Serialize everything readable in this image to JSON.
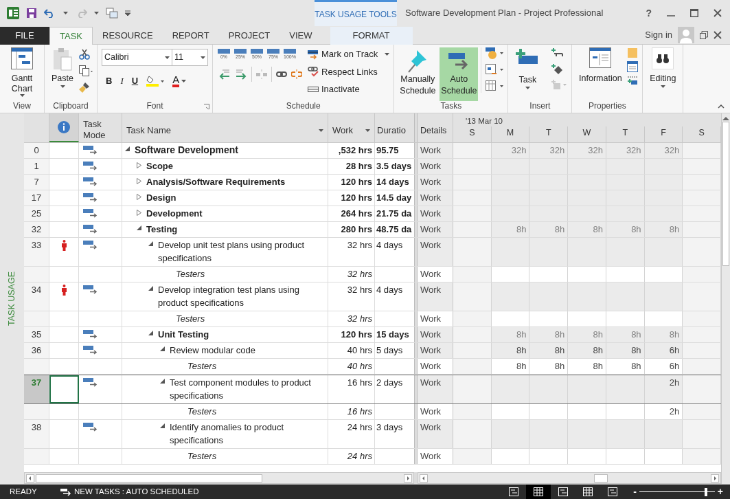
{
  "title_bar": {
    "contextual_header": "TASK USAGE TOOLS",
    "title": "Software Development Plan - Project Professional",
    "help": "?"
  },
  "tabs": [
    {
      "label": "FILE",
      "kind": "file",
      "selected": false
    },
    {
      "label": "TASK",
      "kind": "tab",
      "selected": true
    },
    {
      "label": "RESOURCE",
      "kind": "tab",
      "selected": false
    },
    {
      "label": "REPORT",
      "kind": "tab",
      "selected": false
    },
    {
      "label": "PROJECT",
      "kind": "tab",
      "selected": false
    },
    {
      "label": "VIEW",
      "kind": "tab",
      "selected": false
    },
    {
      "label": "FORMAT",
      "kind": "contextual",
      "selected": false
    }
  ],
  "account": {
    "sign_in": "Sign in"
  },
  "ribbon": {
    "view": {
      "label": "View",
      "gantt_chart": "Gantt Chart"
    },
    "clipboard": {
      "label": "Clipboard",
      "paste": "Paste"
    },
    "font": {
      "label": "Font",
      "family": "Calibri",
      "size": "11",
      "bold": "B",
      "italic": "I",
      "underline": "U",
      "font_color": "A"
    },
    "schedule": {
      "label": "Schedule",
      "percent_buttons": [
        "0%",
        "25%",
        "50%",
        "75%",
        "100%"
      ],
      "mark_on_track": "Mark on Track",
      "respect_links": "Respect Links",
      "inactivate": "Inactivate"
    },
    "tasks": {
      "label": "Tasks",
      "modes": [
        {
          "label": "Manually Schedule",
          "selected": false
        },
        {
          "label": "Auto Schedule",
          "selected": true
        }
      ]
    },
    "insert": {
      "label": "Insert",
      "task": "Task"
    },
    "properties": {
      "label": "Properties",
      "information": "Information"
    },
    "editing": {
      "label": "Editing"
    }
  },
  "side_label": "TASK USAGE",
  "table": {
    "columns": {
      "task_mode": "Task Mode",
      "task_name": "Task Name",
      "work": "Work",
      "duration": "Duratio"
    },
    "timescale": {
      "week": "'13 Mar 10",
      "details": "Details",
      "days": [
        "S",
        "M",
        "T",
        "W",
        "T",
        "F",
        "S"
      ]
    },
    "tasks": [
      {
        "id": "0",
        "kind": "summary",
        "name": "Software Development",
        "work": ",532 hrs",
        "duration": "95.75",
        "expanded": true,
        "indicator": false,
        "selected": false,
        "detail": "Work",
        "hours": {
          "mon": "32h",
          "tue": "32h",
          "wed": "32h",
          "thu": "32h",
          "fri": "32h"
        },
        "children": [
          {
            "id": "1",
            "kind": "summary",
            "name": "Scope",
            "work": "28 hrs",
            "duration": "3.5 days",
            "expanded": false,
            "indicator": false,
            "selected": false,
            "detail": "Work"
          },
          {
            "id": "7",
            "kind": "summary",
            "name": "Analysis/Software Requirements",
            "work": "120 hrs",
            "duration": "14 days",
            "expanded": false,
            "indicator": false,
            "selected": false,
            "detail": "Work"
          },
          {
            "id": "17",
            "kind": "summary",
            "name": "Design",
            "work": "120 hrs",
            "duration": "14.5 day",
            "expanded": false,
            "indicator": false,
            "selected": false,
            "detail": "Work"
          },
          {
            "id": "25",
            "kind": "summary",
            "name": "Development",
            "work": "264 hrs",
            "duration": "21.75 da",
            "expanded": false,
            "indicator": false,
            "selected": false,
            "detail": "Work"
          },
          {
            "id": "32",
            "kind": "summary",
            "name": "Testing",
            "work": "280 hrs",
            "duration": "48.75 da",
            "expanded": true,
            "indicator": false,
            "selected": false,
            "detail": "Work",
            "hours": {
              "mon": "8h",
              "tue": "8h",
              "wed": "8h",
              "thu": "8h",
              "fri": "8h"
            },
            "children": [
              {
                "id": "33",
                "kind": "task",
                "name": "Develop unit test plans using product specifications",
                "work": "32 hrs",
                "duration": "4 days",
                "expanded": true,
                "indicator": true,
                "selected": false,
                "detail": "Work",
                "children": [
                  {
                    "kind": "assignment",
                    "name": "Testers",
                    "work": "32 hrs",
                    "indicator": false,
                    "selected": false,
                    "detail": "Work"
                  }
                ]
              },
              {
                "id": "34",
                "kind": "task",
                "name": "Develop integration test plans using product specifications",
                "work": "32 hrs",
                "duration": "4 days",
                "expanded": true,
                "indicator": true,
                "selected": false,
                "detail": "Work",
                "children": [
                  {
                    "kind": "assignment",
                    "name": "Testers",
                    "work": "32 hrs",
                    "indicator": false,
                    "selected": false,
                    "detail": "Work"
                  }
                ]
              },
              {
                "id": "35",
                "kind": "summary",
                "name": "Unit Testing",
                "work": "120 hrs",
                "duration": "15 days",
                "expanded": true,
                "indicator": false,
                "selected": false,
                "detail": "Work",
                "hours": {
                  "mon": "8h",
                  "tue": "8h",
                  "wed": "8h",
                  "thu": "8h",
                  "fri": "8h"
                },
                "children": [
                  {
                    "id": "36",
                    "kind": "task",
                    "name": "Review modular code",
                    "work": "40 hrs",
                    "duration": "5 days",
                    "expanded": true,
                    "indicator": false,
                    "selected": false,
                    "detail": "Work",
                    "hours": {
                      "mon": "8h",
                      "tue": "8h",
                      "wed": "8h",
                      "thu": "8h",
                      "fri": "6h"
                    },
                    "children": [
                      {
                        "kind": "assignment",
                        "name": "Testers",
                        "work": "40 hrs",
                        "indicator": false,
                        "selected": false,
                        "detail": "Work",
                        "hours": {
                          "mon": "8h",
                          "tue": "8h",
                          "wed": "8h",
                          "thu": "8h",
                          "fri": "6h"
                        }
                      }
                    ]
                  },
                  {
                    "id": "37",
                    "kind": "task",
                    "name": "Test component modules to product specifications",
                    "work": "16 hrs",
                    "duration": "2 days",
                    "expanded": true,
                    "indicator": false,
                    "selected": true,
                    "detail": "Work",
                    "hours": {
                      "fri": "2h"
                    },
                    "children": [
                      {
                        "kind": "assignment",
                        "name": "Testers",
                        "work": "16 hrs",
                        "indicator": false,
                        "selected": false,
                        "detail": "Work",
                        "hours": {
                          "fri": "2h"
                        }
                      }
                    ]
                  },
                  {
                    "id": "38",
                    "kind": "task",
                    "name": "Identify anomalies to product specifications",
                    "work": "24 hrs",
                    "duration": "3 days",
                    "expanded": true,
                    "indicator": false,
                    "selected": false,
                    "detail": "Work",
                    "children": [
                      {
                        "kind": "assignment",
                        "name": "Testers",
                        "work": "24 hrs",
                        "indicator": false,
                        "selected": false,
                        "detail": "Work"
                      }
                    ]
                  }
                ]
              }
            ]
          }
        ]
      }
    ]
  },
  "status_bar": {
    "ready": "READY",
    "new_tasks": "NEW TASKS : AUTO SCHEDULED",
    "views": [
      {
        "selected": false
      },
      {
        "selected": true
      },
      {
        "selected": false
      },
      {
        "selected": false
      },
      {
        "selected": false
      }
    ],
    "zoom": {
      "minus": "-",
      "plus": "+",
      "level": 0.88
    }
  }
}
